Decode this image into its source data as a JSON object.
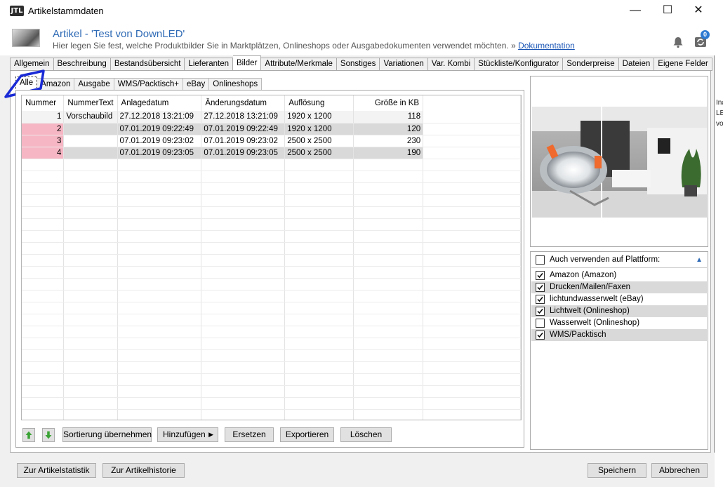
{
  "window": {
    "title": "Artikelstammdaten",
    "logo": "JTL",
    "minimize": "—",
    "maximize": "☐",
    "close": "✕"
  },
  "header": {
    "title": "Artikel - 'Test von DownLED'",
    "subtitle": "Hier legen Sie fest, welche Produktbilder Sie in Marktplätzen, Onlineshops oder Ausgabedokumenten verwendet möchten.",
    "doc_prefix": "»",
    "doc_link": "Dokumentation",
    "badge": "0"
  },
  "tabs": [
    "Allgemein",
    "Beschreibung",
    "Bestandsübersicht",
    "Lieferanten",
    "Bilder",
    "Attribute/Merkmale",
    "Sonstiges",
    "Variationen",
    "Var. Kombi",
    "Stückliste/Konfigurator",
    "Sonderpreise",
    "Dateien",
    "Eigene Felder"
  ],
  "subtabs": [
    "Alle",
    "Amazon",
    "Ausgabe",
    "WMS/Packtisch+",
    "eBay",
    "Onlineshops"
  ],
  "grid": {
    "columns": [
      "Nummer",
      "NummerText",
      "Anlagedatum",
      "Änderungsdatum",
      "Auflösung",
      "Größe in KB"
    ],
    "rows": [
      [
        "1",
        "Vorschaubild",
        "27.12.2018 13:21:09",
        "27.12.2018 13:21:09",
        "1920 x 1200",
        "118"
      ],
      [
        "2",
        "",
        "07.01.2019 09:22:49",
        "07.01.2019 09:22:49",
        "1920 x 1200",
        "120"
      ],
      [
        "3",
        "",
        "07.01.2019 09:23:02",
        "07.01.2019 09:23:02",
        "2500 x 2500",
        "230"
      ],
      [
        "4",
        "",
        "07.01.2019 09:23:05",
        "07.01.2019 09:23:05",
        "2500 x 2500",
        "190"
      ]
    ]
  },
  "buttons": {
    "up": "↑",
    "down": "↓",
    "sort": "Sortierung übernehmen",
    "add": "Hinzufügen",
    "add_arrow": "▶",
    "replace": "Ersetzen",
    "export": "Exportieren",
    "delete": "Löschen"
  },
  "platform": {
    "header": "Auch verwenden auf Plattform:",
    "collapse": "▲",
    "items": [
      {
        "label": "Amazon (Amazon)",
        "checked": true
      },
      {
        "label": "Drucken/Mailen/Faxen",
        "checked": true
      },
      {
        "label": "lichtundwasserwelt (eBay)",
        "checked": true
      },
      {
        "label": "Lichtwelt (Onlineshop)",
        "checked": true
      },
      {
        "label": "Wasserwelt (Onlineshop)",
        "checked": false
      },
      {
        "label": "WMS/Packtisch",
        "checked": true
      }
    ]
  },
  "footer": {
    "stats": "Zur Artikelstatistik",
    "history": "Zur Artikelhistorie",
    "save": "Speichern",
    "cancel": "Abbrechen"
  },
  "right_strip": [
    "Ina",
    "LE",
    "von"
  ],
  "colors": {
    "accent": "#2e6ab5",
    "selection": "#f7b6c4",
    "alt_row": "#d9d9d9",
    "annotation": "#1a2bd6"
  }
}
